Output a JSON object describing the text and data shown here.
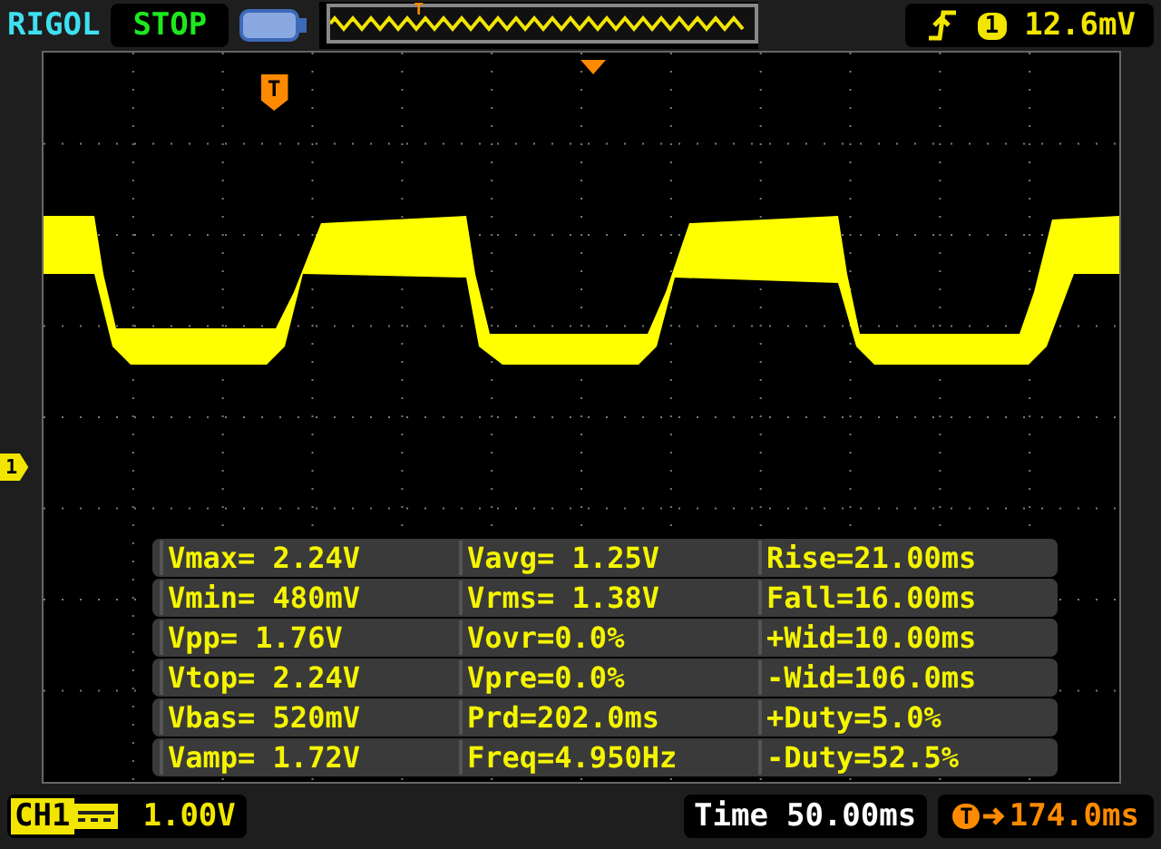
{
  "top_bar": {
    "brand": "RIGOL",
    "run_state": "STOP",
    "overview_marker": "T",
    "trigger_channel": "1",
    "trigger_level": "12.6mV"
  },
  "screen": {
    "trigger_marker": "T",
    "channel_marker": "1",
    "measurements": [
      [
        "Vmax= 2.24V",
        "Vavg= 1.25V",
        "Rise=21.00ms"
      ],
      [
        "Vmin= 480mV",
        "Vrms= 1.38V",
        "Fall=16.00ms"
      ],
      [
        "Vpp= 1.76V",
        "Vovr=0.0%",
        "+Wid=10.00ms"
      ],
      [
        "Vtop= 2.24V",
        "Vpre=0.0%",
        "-Wid=106.0ms"
      ],
      [
        "Vbas= 520mV",
        "Prd=202.0ms",
        "+Duty=5.0%"
      ],
      [
        "Vamp= 1.72V",
        "Freq=4.950Hz",
        "-Duty=52.5%"
      ]
    ]
  },
  "bottom_bar": {
    "channel": "CH1",
    "scale": "1.00V",
    "time_label": "Time",
    "time_value": "50.00ms",
    "offset_icon": "T",
    "offset_value": "174.0ms"
  }
}
